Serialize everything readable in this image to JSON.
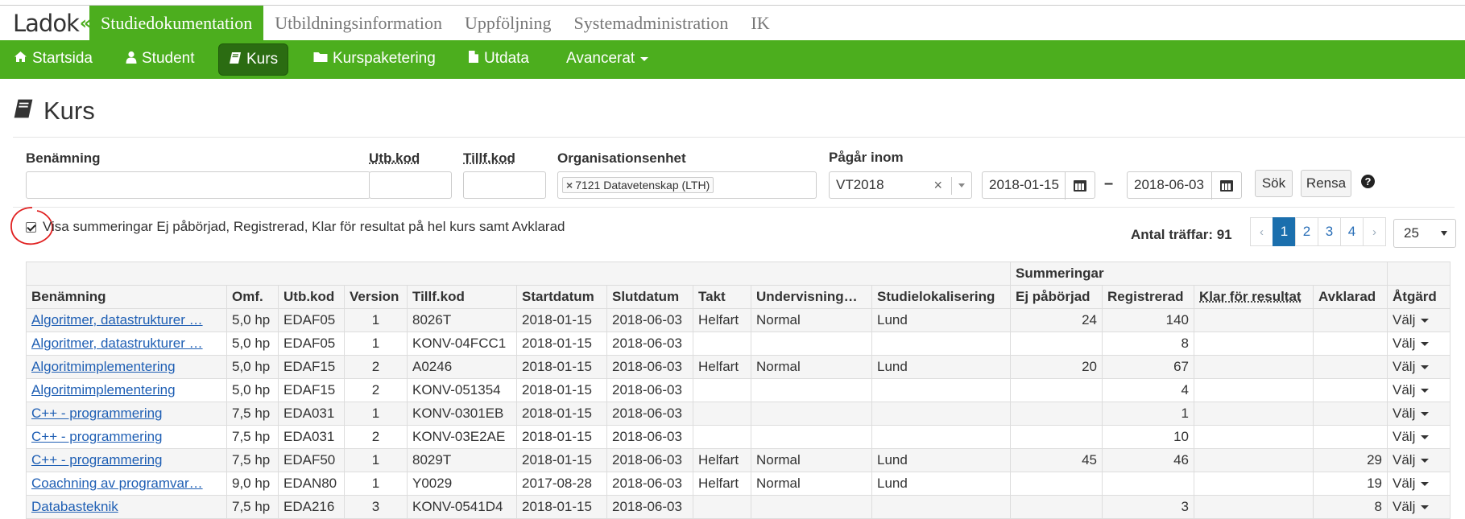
{
  "app": {
    "logo_text": "Ladok",
    "logo_mark": "«"
  },
  "main_nav": [
    {
      "label": "Studiedokumentation",
      "active": true
    },
    {
      "label": "Utbildningsinformation",
      "active": false
    },
    {
      "label": "Uppföljning",
      "active": false
    },
    {
      "label": "Systemadministration",
      "active": false
    },
    {
      "label": "IK",
      "active": false
    }
  ],
  "sub_nav": [
    {
      "label": "Startsida",
      "icon": "home-icon",
      "active": false
    },
    {
      "label": "Student",
      "icon": "user-icon",
      "active": false
    },
    {
      "label": "Kurs",
      "icon": "book-icon",
      "active": true
    },
    {
      "label": "Kurspaketering",
      "icon": "folder-icon",
      "active": false
    },
    {
      "label": "Utdata",
      "icon": "file-icon",
      "active": false
    },
    {
      "label": "Avancerat",
      "icon": "",
      "active": false,
      "dropdown": true
    }
  ],
  "page_title": "Kurs",
  "search": {
    "benamning_label": "Benämning",
    "benamning_value": "",
    "utbkod_label": "Utb.kod",
    "utbkod_value": "",
    "tillfkod_label": "Tillf.kod",
    "tillfkod_value": "",
    "org_label": "Organisationsenhet",
    "org_tag": "7121 Datavetenskap (LTH)",
    "pagar_label": "Pågår inom",
    "pagar_value": "VT2018",
    "date_from": "2018-01-15",
    "date_sep": "–",
    "date_to": "2018-06-03",
    "search_button": "Sök",
    "clear_button": "Rensa",
    "help": "?"
  },
  "summary_checkbox": {
    "checked": true,
    "label": "Visa summeringar Ej påbörjad, Registrerad, Klar för resultat på hel kurs samt Avklarad"
  },
  "hits_label": "Antal träffar: 91",
  "pagination": {
    "prev": "‹",
    "pages": [
      "1",
      "2",
      "3",
      "4"
    ],
    "current": "1",
    "next": "›",
    "page_size": "25"
  },
  "table": {
    "group_header": "Summeringar",
    "columns": [
      "Benämning",
      "Omf.",
      "Utb.kod",
      "Version",
      "Tillf.kod",
      "Startdatum",
      "Slutdatum",
      "Takt",
      "Undervisning…",
      "Studielokalisering",
      "Ej påbörjad",
      "Registrerad",
      "Klar för resultat",
      "Avklarad",
      "Åtgärd"
    ],
    "rows": [
      [
        "Algoritmer, datastrukturer …",
        "5,0 hp",
        "EDAF05",
        "1",
        "8026T",
        "2018-01-15",
        "2018-06-03",
        "Helfart",
        "Normal",
        "Lund",
        "24",
        "140",
        "",
        "",
        "Välj"
      ],
      [
        "Algoritmer, datastrukturer …",
        "5,0 hp",
        "EDAF05",
        "1",
        "KONV-04FCC1",
        "2018-01-15",
        "2018-06-03",
        "",
        "",
        "",
        "",
        "8",
        "",
        "",
        "Välj"
      ],
      [
        "Algoritmimplementering",
        "5,0 hp",
        "EDAF15",
        "2",
        "A0246",
        "2018-01-15",
        "2018-06-03",
        "Helfart",
        "Normal",
        "Lund",
        "20",
        "67",
        "",
        "",
        "Välj"
      ],
      [
        "Algoritmimplementering",
        "5,0 hp",
        "EDAF15",
        "2",
        "KONV-051354",
        "2018-01-15",
        "2018-06-03",
        "",
        "",
        "",
        "",
        "4",
        "",
        "",
        "Välj"
      ],
      [
        "C++ - programmering",
        "7,5 hp",
        "EDA031",
        "1",
        "KONV-0301EB",
        "2018-01-15",
        "2018-06-03",
        "",
        "",
        "",
        "",
        "1",
        "",
        "",
        "Välj"
      ],
      [
        "C++ - programmering",
        "7,5 hp",
        "EDA031",
        "2",
        "KONV-03E2AE",
        "2018-01-15",
        "2018-06-03",
        "",
        "",
        "",
        "",
        "10",
        "",
        "",
        "Välj"
      ],
      [
        "C++ - programmering",
        "7,5 hp",
        "EDAF50",
        "1",
        "8029T",
        "2018-01-15",
        "2018-06-03",
        "Helfart",
        "Normal",
        "Lund",
        "45",
        "46",
        "",
        "29",
        "Välj"
      ],
      [
        "Coachning av programvar…",
        "9,0 hp",
        "EDAN80",
        "1",
        "Y0029",
        "2017-08-28",
        "2018-06-03",
        "Helfart",
        "Normal",
        "Lund",
        "",
        "",
        "",
        "19",
        "Välj"
      ],
      [
        "Databasteknik",
        "7,5 hp",
        "EDA216",
        "3",
        "KONV-0541D4",
        "2018-01-15",
        "2018-06-03",
        "",
        "",
        "",
        "",
        "3",
        "",
        "8",
        "Välj"
      ]
    ]
  }
}
